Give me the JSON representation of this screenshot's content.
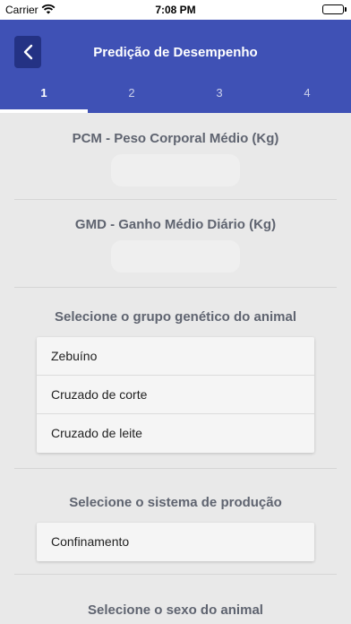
{
  "status_bar": {
    "carrier": "Carrier",
    "time": "7:08 PM"
  },
  "header": {
    "title": "Predição de Desempenho",
    "tabs": [
      "1",
      "2",
      "3",
      "4"
    ],
    "active_tab": "1",
    "background_color": "#3f51b5"
  },
  "form": {
    "pcm_label": "PCM - Peso Corporal Médio (Kg)",
    "pcm_value": "",
    "gmd_label": "GMD - Ganho Médio Diário (Kg)",
    "gmd_value": "",
    "genetic_group": {
      "label": "Selecione o grupo genético do animal",
      "options": [
        "Zebuíno",
        "Cruzado de corte",
        "Cruzado de leite"
      ]
    },
    "production_system": {
      "label": "Selecione o sistema de produção",
      "options": [
        "Confinamento"
      ]
    },
    "sex_label": "Selecione o sexo do animal"
  }
}
